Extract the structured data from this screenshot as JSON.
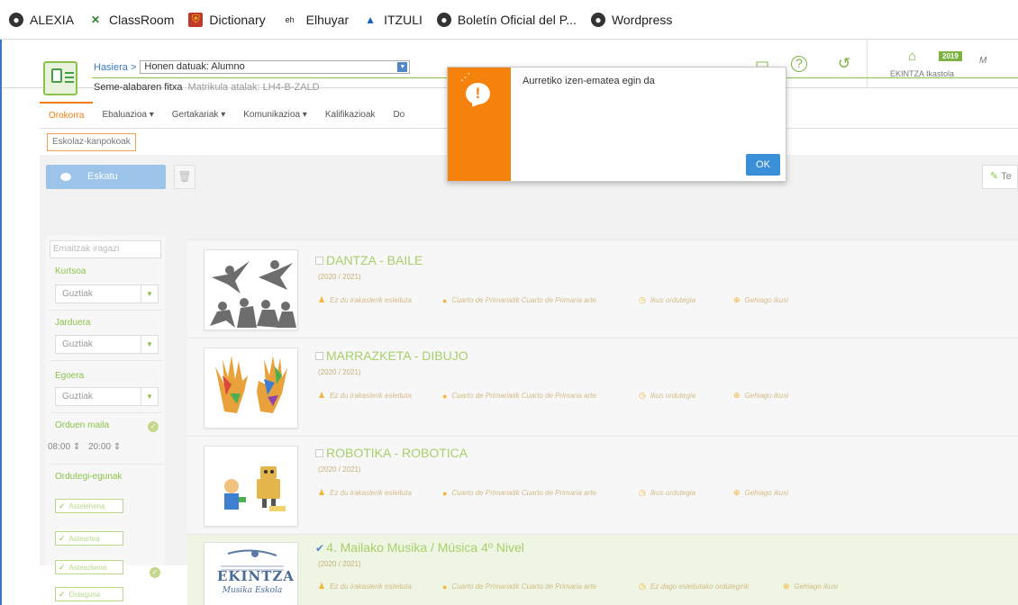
{
  "bookmarks": [
    {
      "label": "ALEXIA",
      "icon": "globe-icon"
    },
    {
      "label": "ClassRoom",
      "icon": "classroom-icon"
    },
    {
      "label": "Dictionary",
      "icon": "dictionary-icon"
    },
    {
      "label": "Elhuyar",
      "icon": "elhuyar-icon"
    },
    {
      "label": "ITZULI",
      "icon": "itzuli-icon"
    },
    {
      "label": "Boletín Oficial del P...",
      "icon": "globe-icon"
    },
    {
      "label": "Wordpress",
      "icon": "globe-icon"
    }
  ],
  "header": {
    "school_year_badge": "2019",
    "school_name": "EKINTZA Ikastola",
    "more_text": "M"
  },
  "student": {
    "breadcrumb_home": "Hasiera >",
    "selector_value": "Honen datuak: Alumno",
    "title": "Seme-alabaren fitxa",
    "matricula": "Matrikula atalak: LH4-B-ZALD"
  },
  "tabs": [
    "Orokorra",
    "Ebaluazioa ▾",
    "Gertakariak ▾",
    "Komunikazioa ▾",
    "Kalifikazioak",
    "Do"
  ],
  "subtab": "Eskolaz-kanpokoak",
  "actions": {
    "request_label": "Eskatu",
    "te_label": "Te"
  },
  "filters": {
    "search_placeholder": "Emaitzak iragazi",
    "kurtsoa_label": "Kurtsoa",
    "kurtsoa_value": "Guztiak",
    "jarduera_label": "Jarduera",
    "jarduera_value": "Guztiak",
    "egoera_label": "Egoera",
    "egoera_value": "Guztiak",
    "orduen_label": "Orduen maila",
    "time_from": "08:00",
    "time_to": "20:00",
    "ordutegi_label": "Ordutegi-egunak",
    "days": [
      "Astelehena",
      "Asteartea",
      "Asteazkena",
      "Osteguna"
    ]
  },
  "activities": [
    {
      "title": "DANTZA - BAILE",
      "year": "(2020 / 2021)",
      "teacher": "Ez du irakaslerik esleituta",
      "course": "Cuarto de Primariatik Cuarto de Primaria arte",
      "schedule": "Ikus ordutegia",
      "more": "Gehiago ikusi",
      "checked": false
    },
    {
      "title": "MARRAZKETA - DIBUJO",
      "year": "(2020 / 2021)",
      "teacher": "Ez du irakaslerik esleituta",
      "course": "Cuarto de Primariatik Cuarto de Primaria arte",
      "schedule": "Ikus ordutegia",
      "more": "Gehiago ikusi",
      "checked": false
    },
    {
      "title": "ROBOTIKA - ROBOTICA",
      "year": "(2020 / 2021)",
      "teacher": "Ez du irakaslerik esleituta",
      "course": "Cuarto de Primariatik Cuarto de Primaria arte",
      "schedule": "Ikus ordutegia",
      "more": "Gehiago ikusi",
      "checked": false
    },
    {
      "title": "4. Mailako Musika / Música 4º Nivel",
      "year": "(2020 / 2021)",
      "teacher": "Ez du irakaslerik esleituta",
      "course": "Cuarto de Primariatik Cuarto de Primaria arte",
      "schedule": "Ez dago esleitutako ordutegirik",
      "more": "Gehiago ikusi",
      "checked": true,
      "logo_text": "EKINTZA",
      "logo_sub": "Musika Eskola"
    }
  ],
  "dialog": {
    "message": "Aurretiko izen-ematea egin da",
    "ok_label": "OK"
  },
  "colors": {
    "accent_green": "#8bc34a",
    "accent_orange": "#f5820d",
    "accent_blue": "#3a8fd9"
  }
}
